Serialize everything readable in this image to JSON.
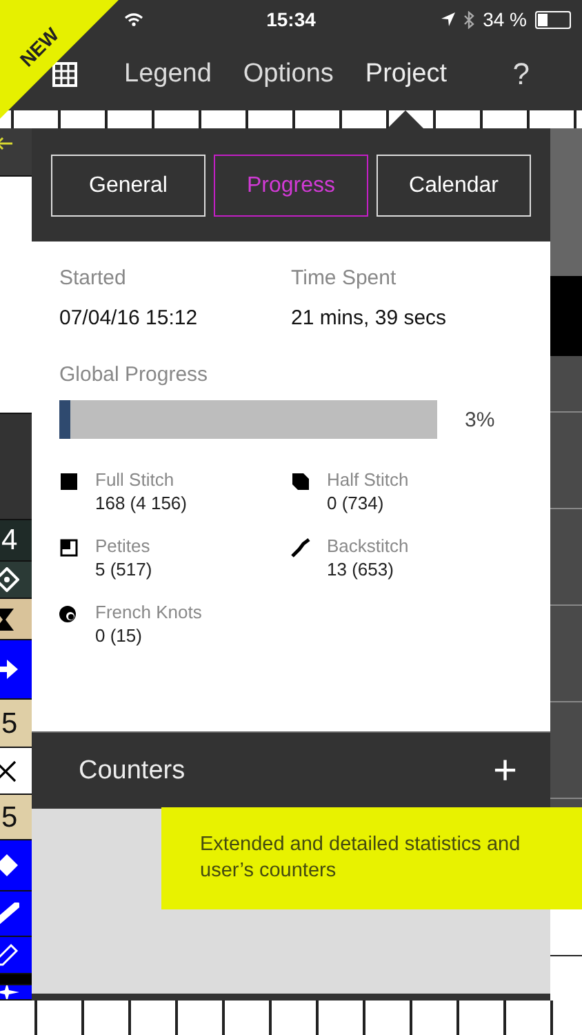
{
  "status_bar": {
    "time": "15:34",
    "battery": "34 %"
  },
  "badge": "NEW",
  "nav": {
    "items": [
      {
        "label": "Legend",
        "selected": false
      },
      {
        "label": "Options",
        "selected": false
      },
      {
        "label": "Project",
        "selected": true
      }
    ],
    "help": "?"
  },
  "symbol_strip": [
    {
      "kind": "back",
      "color": "#3a3a3a"
    },
    {
      "kind": "blank",
      "color": "#ffffff"
    },
    {
      "kind": "blank",
      "color": "#333333"
    },
    {
      "kind": "number",
      "label": "4",
      "color": "#1f2b28"
    },
    {
      "kind": "diamond-outline",
      "color": "#2b3a36"
    },
    {
      "kind": "hourglass",
      "color": "#d9c39a"
    },
    {
      "kind": "arrow",
      "color": "#0000ff"
    },
    {
      "kind": "number",
      "label": "5",
      "color": "#dfcfa6"
    },
    {
      "kind": "cross",
      "color": "#ffffff"
    },
    {
      "kind": "number",
      "label": "5",
      "color": "#dfcfa6"
    },
    {
      "kind": "diamond",
      "color": "#0000ff"
    },
    {
      "kind": "bar",
      "color": "#0000ff"
    },
    {
      "kind": "pencil",
      "color": "#0000ff"
    },
    {
      "kind": "blank",
      "color": "#000000"
    },
    {
      "kind": "star",
      "color": "#0000ff"
    }
  ],
  "panel": {
    "tabs": [
      {
        "label": "General",
        "selected": false
      },
      {
        "label": "Progress",
        "selected": true
      },
      {
        "label": "Calendar",
        "selected": false
      }
    ],
    "started": {
      "label": "Started",
      "value": "07/04/16 15:12"
    },
    "time_spent": {
      "label": "Time Spent",
      "value": "21 mins, 39 secs"
    },
    "global_progress": {
      "label": "Global Progress",
      "level": 0.03,
      "reading": "3%"
    },
    "stitches": [
      {
        "kind": "full",
        "name": "Full Stitch",
        "count": "168 (4 156)"
      },
      {
        "kind": "half",
        "name": "Half Stitch",
        "count": "0 (734)"
      },
      {
        "kind": "petites",
        "name": "Petites",
        "count": "5 (517)"
      },
      {
        "kind": "backstitch",
        "name": "Backstitch",
        "count": "13 (653)"
      },
      {
        "kind": "french",
        "name": "French Knots",
        "count": "0 (15)"
      }
    ],
    "counters": {
      "title": "Counters",
      "add": "+"
    }
  },
  "callout": "Extended and detailed statistics and user’s counters"
}
